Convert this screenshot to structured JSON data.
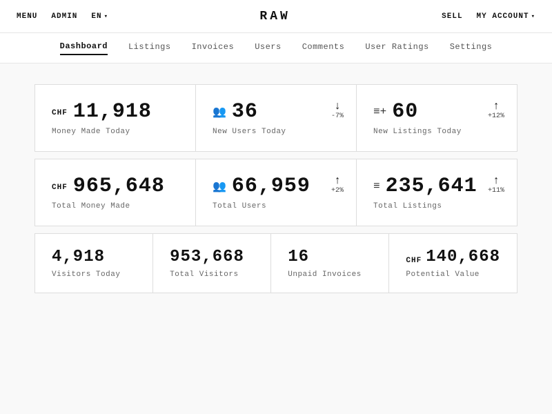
{
  "app": {
    "title": "RAW"
  },
  "topnav": {
    "menu": "MENU",
    "admin": "ADMIN",
    "lang": "EN",
    "sell": "SELL",
    "myaccount": "MY ACCOUNT"
  },
  "subnav": {
    "items": [
      {
        "label": "Dashboard",
        "active": true
      },
      {
        "label": "Listings",
        "active": false
      },
      {
        "label": "Invoices",
        "active": false
      },
      {
        "label": "Users",
        "active": false
      },
      {
        "label": "Comments",
        "active": false
      },
      {
        "label": "User Ratings",
        "active": false
      },
      {
        "label": "Settings",
        "active": false
      }
    ]
  },
  "row1": [
    {
      "currency": "CHF",
      "icon": "money",
      "value": "11,918",
      "label": "Money Made Today",
      "trend_arrow": "↓",
      "trend_pct": ""
    },
    {
      "icon": "👤+",
      "value": "36",
      "label": "New Users Today",
      "trend_arrow": "↓",
      "trend_pct": "-7%"
    },
    {
      "icon": "list+",
      "value": "60",
      "label": "New Listings Today",
      "trend_arrow": "↑",
      "trend_pct": "+12%"
    }
  ],
  "row2": [
    {
      "currency": "CHF",
      "value": "965,648",
      "label": "Total Money Made",
      "trend_arrow": "",
      "trend_pct": ""
    },
    {
      "icon": "👥",
      "value": "66,959",
      "label": "Total Users",
      "trend_arrow": "↑",
      "trend_pct": "+2%"
    },
    {
      "icon": "list",
      "value": "235,641",
      "label": "Total Listings",
      "trend_arrow": "↑",
      "trend_pct": "+11%"
    }
  ],
  "row3": [
    {
      "value": "4,918",
      "label": "Visitors Today"
    },
    {
      "value": "953,668",
      "label": "Total Visitors"
    },
    {
      "value": "16",
      "label": "Unpaid Invoices"
    },
    {
      "currency": "CHF",
      "value": "140,668",
      "label": "Potential Value"
    }
  ]
}
